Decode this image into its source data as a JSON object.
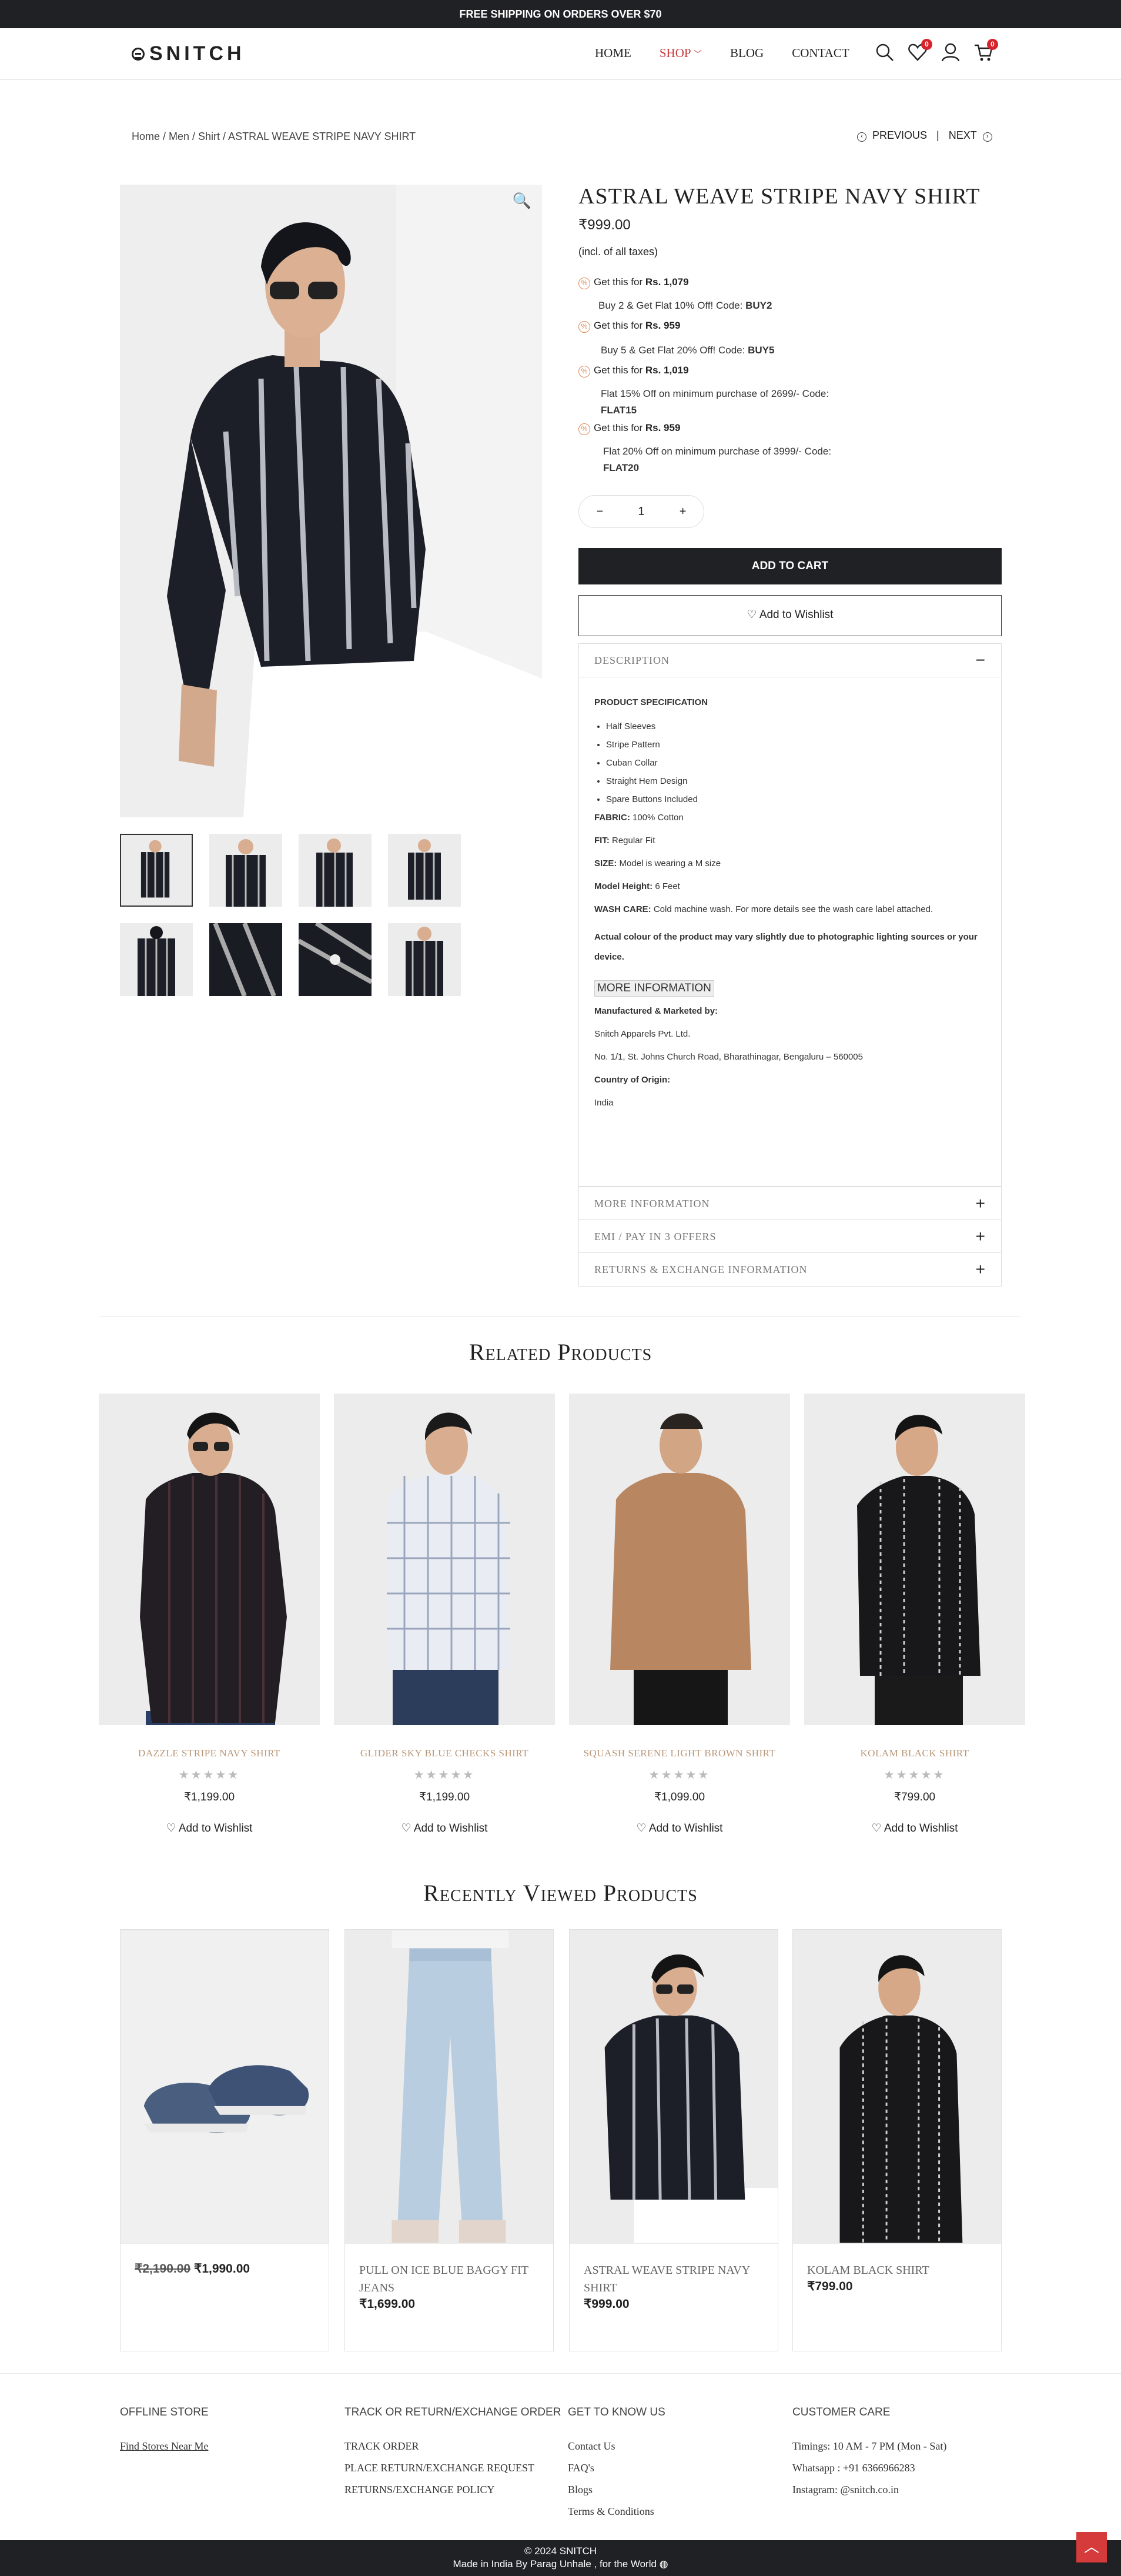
{
  "topbar": {
    "text": "FREE SHIPPING ON ORDERS OVER $70"
  },
  "header": {
    "logo": "SNITCH",
    "nav": [
      "HOME",
      "SHOP",
      "BLOG",
      "CONTACT"
    ],
    "wishlist_count": "0",
    "cart_count": "0"
  },
  "breadcrumb": "Home / Men / Shirt / ASTRAL WEAVE STRIPE NAVY SHIRT",
  "pager": {
    "previous": "PREVIOUS",
    "next": "NEXT",
    "sep": "|"
  },
  "product": {
    "title": "ASTRAL WEAVE STRIPE NAVY SHIRT",
    "price": "₹999.00",
    "tax": "(incl. of all taxes)",
    "offers": [
      {
        "label": "Get this for ",
        "amount": "Rs. 1,079",
        "desc": "Buy 2 & Get Flat 10% Off! Code: ",
        "code": "BUY2"
      },
      {
        "label": "Get this for ",
        "amount": "Rs. 959",
        "desc": "Buy 5 & Get Flat 20% Off! Code: ",
        "code": "BUY5"
      },
      {
        "label": "Get this for ",
        "amount": "Rs. 1,019",
        "desc": "Flat 15% Off on minimum purchase of 2699/- Code: ",
        "code": "FLAT15"
      },
      {
        "label": "Get this for ",
        "amount": "Rs. 959",
        "desc": "Flat 20% Off on minimum purchase of 3999/- Code: ",
        "code": "FLAT20"
      }
    ],
    "qty": "1",
    "add_to_cart": "ADD TO CART",
    "add_to_wishlist": "Add to Wishlist"
  },
  "description": {
    "title": "DESCRIPTION",
    "spec_title": "PRODUCT SPECIFICATION",
    "specs": [
      "Half Sleeves",
      "Stripe Pattern",
      "Cuban Collar",
      "Straight Hem Design",
      "Spare Buttons Included"
    ],
    "fabric_label": "FABRIC:",
    "fabric": " 100% Cotton",
    "fit_label": "FIT:",
    "fit": " Regular Fit",
    "size_label": "SIZE:",
    "size": " Model is wearing a M size",
    "height_label": "Model Height:",
    "height": " 6 Feet",
    "wash_label": "WASH CARE:",
    "wash": " Cold machine wash. For more details see the wash care label attached.",
    "note": "Actual colour of the product may vary slightly due to photographic lighting sources or your device.",
    "more_info_btn": "MORE INFORMATION",
    "mfg_label": "Manufactured & Marketed by:",
    "mfg_name": "Snitch Apparels Pvt. Ltd.",
    "mfg_addr": "No. 1/1, St. Johns Church Road, Bharathinagar, Bengaluru – 560005",
    "origin_label": "Country of Origin:",
    "origin": "India"
  },
  "accordions": [
    "MORE INFORMATION",
    "EMI / PAY IN 3 OFFERS",
    "RETURNS & EXCHANGE INFORMATION"
  ],
  "related": {
    "title": "Related Products",
    "items": [
      {
        "name": "DAZZLE STRIPE NAVY SHIRT",
        "price": "₹1,199.00",
        "wish": "Add to Wishlist"
      },
      {
        "name": "GLIDER SKY BLUE CHECKS SHIRT",
        "price": "₹1,199.00",
        "wish": "Add to Wishlist"
      },
      {
        "name": "SQUASH SERENE LIGHT BROWN SHIRT",
        "price": "₹1,099.00",
        "wish": "Add to Wishlist"
      },
      {
        "name": "KOLAM BLACK SHIRT",
        "price": "₹799.00",
        "wish": "Add to Wishlist"
      }
    ],
    "stars": "★★★★★"
  },
  "recent": {
    "title": "Recently Viewed Products",
    "items": [
      {
        "name": "",
        "old": "₹2,190.00",
        "price": "₹1,990.00"
      },
      {
        "name": "PULL ON ICE BLUE BAGGY FIT JEANS",
        "price": "₹1,699.00"
      },
      {
        "name": "ASTRAL WEAVE STRIPE NAVY SHIRT",
        "price": "₹999.00"
      },
      {
        "name": "KOLAM BLACK SHIRT",
        "price": "₹799.00"
      }
    ]
  },
  "footer": {
    "col1": {
      "title": "OFFLINE STORE",
      "links": [
        "Find Stores Near Me"
      ]
    },
    "col2": {
      "title": "TRACK OR RETURN/EXCHANGE ORDER",
      "links": [
        "TRACK ORDER",
        "PLACE RETURN/EXCHANGE REQUEST",
        "RETURNS/EXCHANGE POLICY"
      ]
    },
    "col3": {
      "title": "GET TO KNOW US",
      "links": [
        "Contact Us",
        "FAQ's",
        "Blogs",
        "Terms & Conditions"
      ]
    },
    "col4": {
      "title": "CUSTOMER CARE",
      "links": [
        "Timings: 10 AM - 7 PM (Mon - Sat)",
        "Whatsapp : +91 6366966283",
        "Instagram: @snitch.co.in"
      ]
    },
    "copyright": "© 2024 SNITCH",
    "made": "Made in India By Parag Unhale , for the World"
  }
}
